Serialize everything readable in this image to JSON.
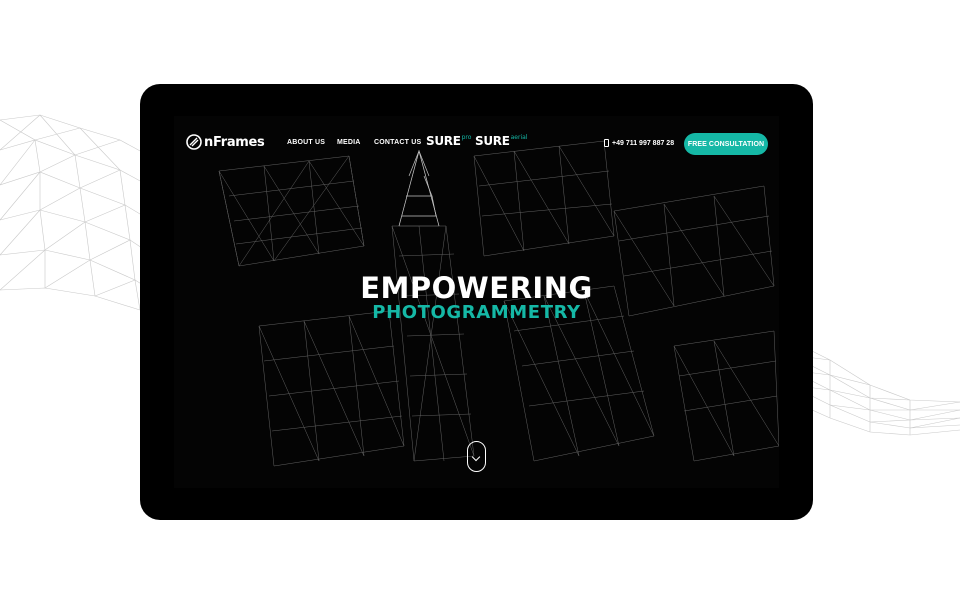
{
  "site": {
    "logo_text": "nFrames",
    "nav": {
      "about": "ABOUT US",
      "media": "MEDIA",
      "contact": "CONTACT US"
    },
    "products": [
      {
        "name": "SURE",
        "suffix": "pro"
      },
      {
        "name": "SURE",
        "suffix": "aerial"
      }
    ],
    "phone": "+49 711 997 887 28",
    "cta_label": "FREE CONSULTATION"
  },
  "hero": {
    "title": "EMPOWERING",
    "subtitle": "PHOTOGRAMMETRY"
  },
  "colors": {
    "accent": "#15b8a6",
    "screen_bg": "#050505",
    "device": "#000000"
  },
  "icons": [
    "logo-mark-icon",
    "phone-icon",
    "scroll-down-icon",
    "chevron-down-icon"
  ]
}
